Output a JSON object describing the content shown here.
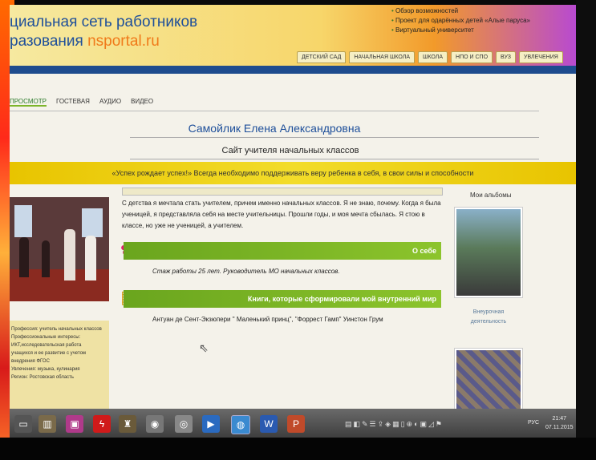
{
  "header": {
    "site_title_line1": "циальная сеть работников",
    "site_title_line2_prefix": "разования ",
    "site_title_line2_accent": "nsportal.ru",
    "promo_links": [
      "Обзор возможностей",
      "Проект для одарённых детей «Алые паруса»",
      "Виртуальный университет"
    ],
    "level_tabs": [
      "ДЕТСКИЙ САД",
      "НАЧАЛЬНАЯ ШКОЛА",
      "ШКОЛА",
      "НПО И СПО",
      "ВУЗ",
      "УВЛЕЧЕНИЯ"
    ]
  },
  "page_tabs": [
    "ПРОСМОТР",
    "ГОСТЕВАЯ",
    "АУДИО",
    "ВИДЕО"
  ],
  "person_name": "Самойлик Елена Александровна",
  "site_subtitle": "Сайт учителя начальных классов",
  "quote": "«Успех рождает успех!» Всегда необходимо поддерживать веру ребенка в себя, в свои силы и способности",
  "left_info": [
    "Профессия: учитель начальных классов",
    "Профессиональные интересы:",
    "ИКТ,исследовательская работа",
    "учащихся и ее развитие с учетом",
    "внедрения ФГОС",
    "Увлечения: музыка, кулинария",
    "Регион: Ростовская область"
  ],
  "intro_text": "С детства я мечтала стать учителем, причем именно начальных классов. Я не знаю, почему. Когда я была ученицей, я представляла себя на месте учительницы. Прошли годы, и моя мечта сбылась. Я стою в классе, но уже не ученицей, а учителем.",
  "sections": {
    "about_title": "О себе",
    "about_text": "Стаж работы 25 лет. Руководитель МО начальных классов.",
    "books_title": "Книги, которые сформировали мой внутренний мир",
    "books_text": "Антуан де Сент-Экзюпери \" Маленький принц\", \"Форрест Гамп\" Уинстон Грум"
  },
  "albums": {
    "title": "Мои альбомы",
    "album1_caption_line1": "Внеурочная",
    "album1_caption_line2": "деятельность"
  },
  "taskbar": {
    "language": "РУС",
    "time": "21:47",
    "date": "07.11.2015"
  },
  "colors": {
    "brand_blue": "#1e4f9a",
    "accent_orange": "#f07a1a",
    "section_green": "#7db52b",
    "quote_yellow": "#f2dc2a"
  }
}
